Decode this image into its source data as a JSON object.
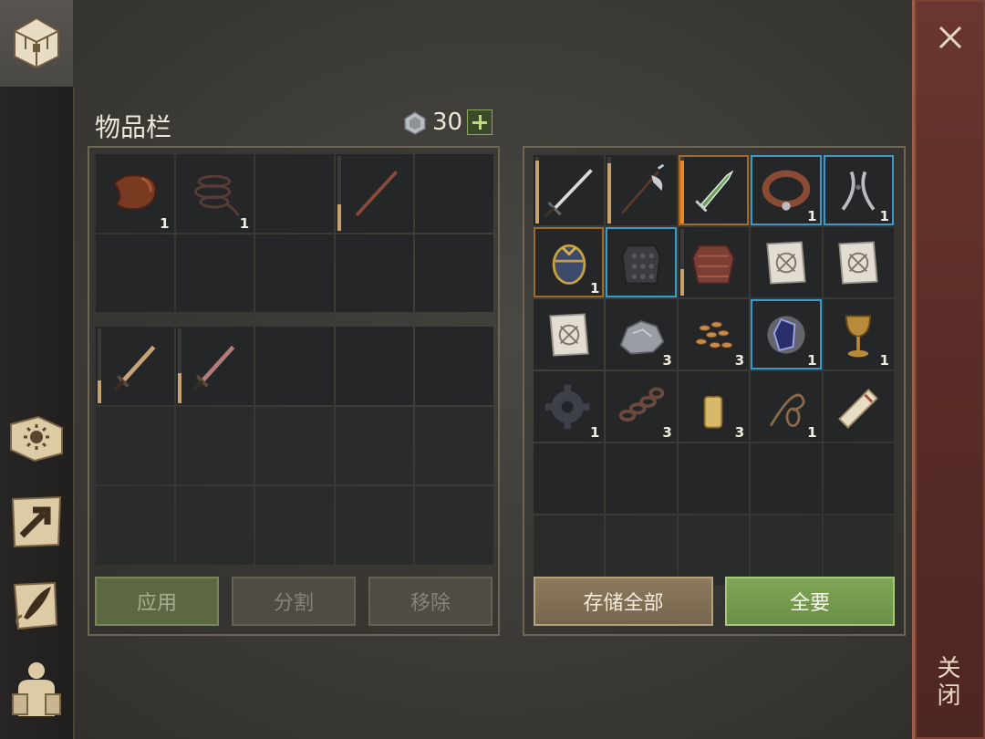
{
  "inventory": {
    "title": "物品栏",
    "currency_value": "30",
    "top_slots": [
      {
        "item": "leather",
        "count": "1"
      },
      {
        "item": "rope",
        "count": "1"
      },
      {
        "item": "",
        "count": ""
      },
      {
        "item": "stick",
        "count": "",
        "durability": 0.35
      },
      {
        "item": "",
        "count": ""
      }
    ],
    "bottom_slots": [
      {
        "item": "short-sword",
        "count": "",
        "durability": 0.3
      },
      {
        "item": "red-sword",
        "count": "",
        "durability": 0.4
      }
    ],
    "buttons": {
      "apply": "应用",
      "split": "分割",
      "remove": "移除"
    }
  },
  "storage": {
    "slots": [
      {
        "item": "longsword",
        "count": "",
        "durability": 0.95
      },
      {
        "item": "halberd",
        "count": "",
        "durability": 0.9
      },
      {
        "item": "jade-dagger",
        "count": "",
        "durability": 0.95
      },
      {
        "item": "collar",
        "count": "1"
      },
      {
        "item": "pliers",
        "count": "1"
      },
      {
        "item": "egg",
        "count": "1"
      },
      {
        "item": "chainmail",
        "count": ""
      },
      {
        "item": "tunic",
        "count": "",
        "durability": 0.4
      },
      {
        "item": "blueprint",
        "count": ""
      },
      {
        "item": "blueprint",
        "count": ""
      },
      {
        "item": "blueprint",
        "count": ""
      },
      {
        "item": "stone",
        "count": "3"
      },
      {
        "item": "seeds",
        "count": "3"
      },
      {
        "item": "crystal",
        "count": "1"
      },
      {
        "item": "goblet",
        "count": "1"
      },
      {
        "item": "gear",
        "count": "1"
      },
      {
        "item": "chain",
        "count": "3"
      },
      {
        "item": "candle",
        "count": "3"
      },
      {
        "item": "noose",
        "count": "1"
      },
      {
        "item": "scroll",
        "count": ""
      }
    ],
    "buttons": {
      "store_all": "存储全部",
      "take_all": "全要"
    }
  },
  "close_label": "关闭",
  "sidebar_icons": [
    "chest-icon",
    "sun-book-icon",
    "arrow-map-icon",
    "quill-scroll-icon",
    "backpack-icon"
  ],
  "colors": {
    "accent_green": "#7fa656",
    "close_bar": "#5a2c27",
    "rarity_blue": "#3a9ac8",
    "rarity_orange": "#a06a2a"
  }
}
